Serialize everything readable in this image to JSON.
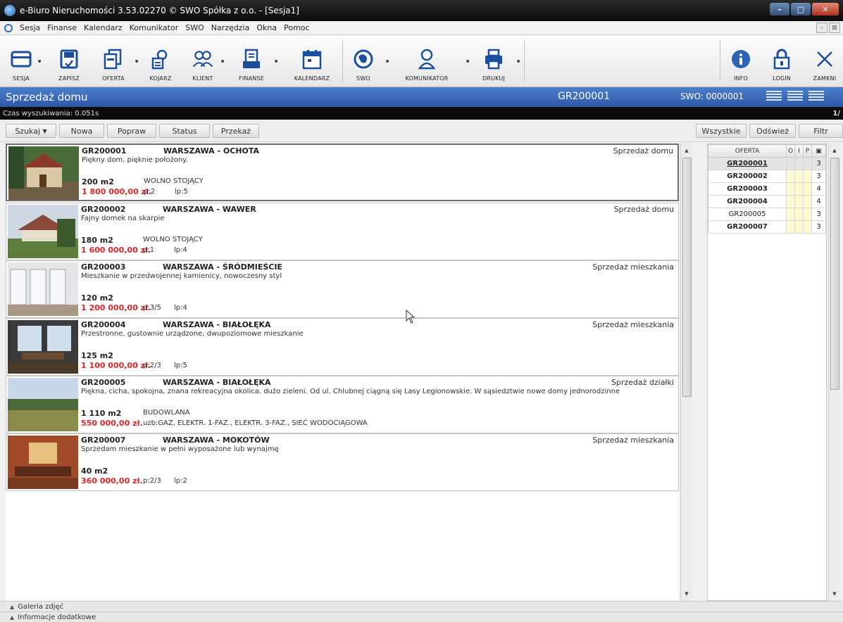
{
  "window": {
    "title": "e-Biuro Nieruchomości 3.53.02270 © SWO Spółka z o.o. - [Sesja1]"
  },
  "menu": [
    "Sesja",
    "Finanse",
    "Kalendarz",
    "Komunikator",
    "SWO",
    "Narzędzia",
    "Okna",
    "Pomoc"
  ],
  "toolbar": {
    "sesja": "SESJA",
    "zapisz": "ZAPISZ",
    "oferta": "OFERTA",
    "kojarz": "KOJARZ",
    "klient": "KLIENT",
    "finanse": "FINANSE",
    "kalendarz": "KALENDARZ",
    "swo": "SWO",
    "komunikator": "KOMUNIKATOR",
    "drukuj": "DRUKUJ",
    "info": "INFO",
    "login": "LOGIN",
    "zamknij": "ZAMKNI"
  },
  "header": {
    "title": "Sprzedaż domu",
    "code": "GR200001",
    "swo": "SWO: 0000001"
  },
  "status": {
    "search_time": "Czas wyszukiwania: 0.051s",
    "page": "1/"
  },
  "actions": {
    "szukaj": "Szukaj",
    "nowa": "Nowa",
    "popraw": "Popraw",
    "status": "Status",
    "przekaz": "Przekaż",
    "wszystkie": "Wszystkie",
    "odswiez": "Odśwież",
    "filtr": "Filtr"
  },
  "listings": [
    {
      "code": "GR200001",
      "city": "WARSZAWA - OCHOTA",
      "kind": "Sprzedaż domu",
      "desc": "Piękny dom, pięknie położony.",
      "area": "200 m2",
      "type": "WOLNO STOJĄCY",
      "price": "1 800 000,00 zł.",
      "p1": "p:2",
      "p2": "lp:5"
    },
    {
      "code": "GR200002",
      "city": "WARSZAWA - WAWER",
      "kind": "Sprzedaż domu",
      "desc": "Fajny domek na skarpie",
      "area": "180 m2",
      "type": "WOLNO STOJĄCY",
      "price": "1 600 000,00 zł.",
      "p1": "p:1",
      "p2": "lp:4"
    },
    {
      "code": "GR200003",
      "city": "WARSZAWA - ŚRÓDMIEŚCIE",
      "kind": "Sprzedaż mieszkania",
      "desc": "Mieszkanie w przedwojennej kamienicy, nowoczesny styl",
      "area": "120 m2",
      "type": "",
      "price": "1 200 000,00 zł.",
      "p1": "p:3/5",
      "p2": "lp:4"
    },
    {
      "code": "GR200004",
      "city": "WARSZAWA - BIAŁOŁĘKA",
      "kind": "Sprzedaż mieszkania",
      "desc": "Przestronne, gustownie urządzone, dwupoziomowe mieszkanie",
      "area": "125 m2",
      "type": "",
      "price": "1 100 000,00 zł.",
      "p1": "p:2/3",
      "p2": "lp:5"
    },
    {
      "code": "GR200005",
      "city": "WARSZAWA - BIAŁOŁĘKA",
      "kind": "Sprzedaż działki",
      "desc": "Piękna, cicha, spokojna, znana rekreacyjna okolica, dużo zieleni. Od ul. Chlubnej ciągną się Lasy Legionowskie. W sąsiedztwie nowe domy jednorodzinne",
      "area": "1 110 m2",
      "type": "BUDOWLANA",
      "price": "550 000,00 zł.",
      "p1": "uzb:GAZ, ELEKTR. 1-FAZ., ELEKTR. 3-FAZ., SIEĆ WODOCIĄGOWA",
      "p2": ""
    },
    {
      "code": "GR200007",
      "city": "WARSZAWA - MOKOTÓW",
      "kind": "Sprzedaż mieszkania",
      "desc": "Sprzedam mieszkanie w pełni wyposażone lub wynajmę",
      "area": "40 m2",
      "type": "",
      "price": "360 000,00 zł.",
      "p1": "p:2/3",
      "p2": "lp:2"
    }
  ],
  "side_table": {
    "headers": [
      "OFERTA",
      "O",
      "I",
      "P"
    ],
    "rows": [
      {
        "code": "GR200001",
        "count": "3"
      },
      {
        "code": "GR200002",
        "count": "3"
      },
      {
        "code": "GR200003",
        "count": "4"
      },
      {
        "code": "GR200004",
        "count": "4"
      },
      {
        "code": "GR200005",
        "count": "3"
      },
      {
        "code": "GR200007",
        "count": "3"
      }
    ]
  },
  "bottom": {
    "gallery": "Galeria zdjęć",
    "info": "Informacje dodatkowe"
  }
}
